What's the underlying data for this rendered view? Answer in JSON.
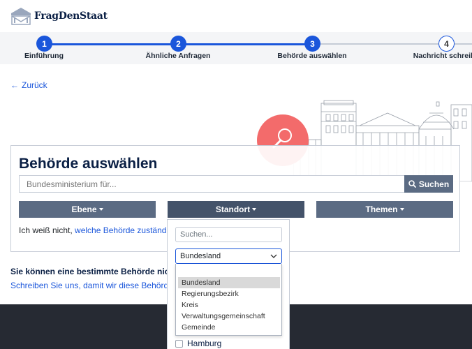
{
  "brand": {
    "name": "FragDenStaat"
  },
  "steps": [
    {
      "number": "1",
      "label": "Einführung"
    },
    {
      "number": "2",
      "label": "Ähnliche Anfragen"
    },
    {
      "number": "3",
      "label": "Behörde auswählen"
    },
    {
      "number": "4",
      "label": "Nachricht schreibe"
    }
  ],
  "back_link": "Zurück",
  "panel": {
    "title": "Behörde auswählen",
    "search_placeholder": "Bundesministerium für...",
    "search_button": "Suchen",
    "filters": [
      "Ebene",
      "Standort",
      "Themen"
    ],
    "hint_prefix": "Ich weiß nicht, ",
    "hint_link": "welche Behörde zuständig"
  },
  "info": {
    "line1": "Sie können eine bestimmte Behörde nicht fin",
    "line2": "Schreiben Sie uns, damit wir diese Behörde in"
  },
  "dropdown": {
    "search_placeholder": "Suchen...",
    "selected": "Bundesland",
    "options": [
      "Bundesland",
      "Regierungsbezirk",
      "Kreis",
      "Verwaltungsgemeinschaft",
      "Gemeinde"
    ],
    "checkbox_label": "Hamburg"
  },
  "colors": {
    "primary": "#1a56db",
    "button": "#5b6b83",
    "footer": "#262a33",
    "accent_red": "#f36b6b"
  }
}
